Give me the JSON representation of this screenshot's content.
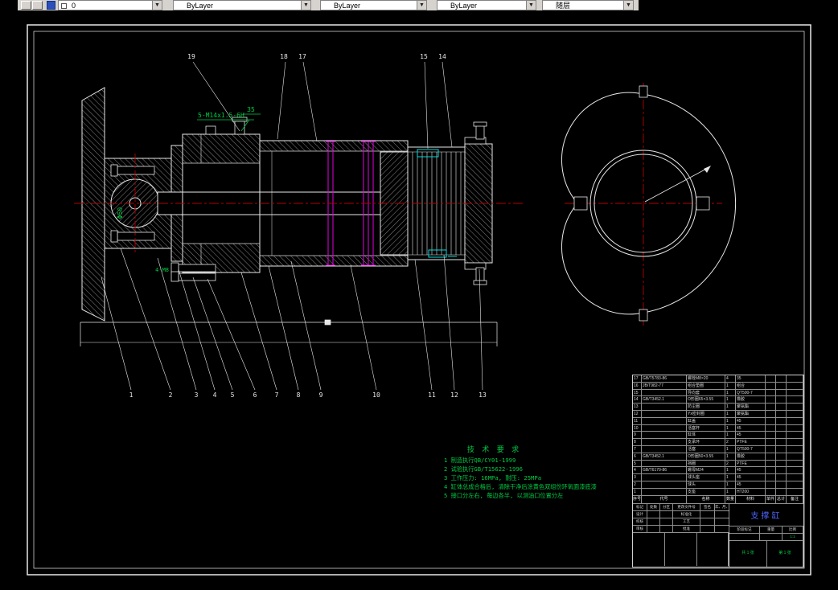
{
  "toolbar": {
    "layer_value": "0",
    "combo2_value": "ByLayer",
    "combo3_value": "ByLayer",
    "combo4_value": "ByLayer",
    "plot_style_value": "随层"
  },
  "drawing": {
    "thread_note": "5-M14x1.5-6H",
    "dim_35": "35",
    "dia_label": "Φ50",
    "bolt_note": "4-M8",
    "callouts_top": [
      "19",
      "18",
      "17",
      "15",
      "14"
    ],
    "callouts_bottom": [
      "1",
      "2",
      "3",
      "4",
      "5",
      "6",
      "7",
      "8",
      "9",
      "10",
      "11",
      "12",
      "13"
    ]
  },
  "tech_requirements": {
    "title": "技 术 要 求",
    "lines": [
      "1 制造执行QB/CY01-1999",
      "2 试验执行GB/T15622-1996",
      "3 工作压力: 16MPa, 耐压: 25MPa",
      "4 缸体总成合格后, 清除干净后涂黄色双组份环氧面漆底漆",
      "5 接口分左右, 每边各半, 以测油口位置分左"
    ]
  },
  "bom": {
    "headers": [
      "序号",
      "代号",
      "名称",
      "数量",
      "材料",
      "单件",
      "总计",
      "备注"
    ],
    "rows": [
      {
        "n": "17",
        "code": "GB/T5783-86",
        "name": "螺栓M8×20",
        "qty": "4",
        "mat": "35",
        "w1": "",
        "w2": "",
        "note": ""
      },
      {
        "n": "16",
        "code": "JB/T982-77",
        "name": "组合垫圈",
        "qty": "1",
        "mat": "组合",
        "w1": "",
        "w2": "",
        "note": ""
      },
      {
        "n": "15",
        "code": "",
        "name": "导向套",
        "qty": "1",
        "mat": "QT500-7",
        "w1": "",
        "w2": "",
        "note": ""
      },
      {
        "n": "14",
        "code": "GB/T3452.1",
        "name": "O形圈65×3.55",
        "qty": "1",
        "mat": "橡胶",
        "w1": "",
        "w2": "",
        "note": ""
      },
      {
        "n": "13",
        "code": "",
        "name": "防尘圈",
        "qty": "1",
        "mat": "聚氨酯",
        "w1": "",
        "w2": "",
        "note": ""
      },
      {
        "n": "12",
        "code": "",
        "name": "Yx密封圈",
        "qty": "1",
        "mat": "聚氨酯",
        "w1": "",
        "w2": "",
        "note": ""
      },
      {
        "n": "11",
        "code": "",
        "name": "缸盖",
        "qty": "1",
        "mat": "45",
        "w1": "",
        "w2": "",
        "note": ""
      },
      {
        "n": "10",
        "code": "",
        "name": "活塞杆",
        "qty": "1",
        "mat": "45",
        "w1": "",
        "w2": "",
        "note": ""
      },
      {
        "n": "9",
        "code": "",
        "name": "缸体",
        "qty": "1",
        "mat": "45",
        "w1": "",
        "w2": "",
        "note": ""
      },
      {
        "n": "8",
        "code": "",
        "name": "支承环",
        "qty": "2",
        "mat": "PTFE",
        "w1": "",
        "w2": "",
        "note": ""
      },
      {
        "n": "7",
        "code": "",
        "name": "活塞",
        "qty": "1",
        "mat": "QT500-7",
        "w1": "",
        "w2": "",
        "note": ""
      },
      {
        "n": "6",
        "code": "GB/T3452.1",
        "name": "O形圈50×3.55",
        "qty": "1",
        "mat": "橡胶",
        "w1": "",
        "w2": "",
        "note": ""
      },
      {
        "n": "5",
        "code": "",
        "name": "挡圈",
        "qty": "2",
        "mat": "PTFE",
        "w1": "",
        "w2": "",
        "note": ""
      },
      {
        "n": "4",
        "code": "GB/T6170-86",
        "name": "螺母M24",
        "qty": "1",
        "mat": "45",
        "w1": "",
        "w2": "",
        "note": ""
      },
      {
        "n": "3",
        "code": "",
        "name": "球头座",
        "qty": "1",
        "mat": "45",
        "w1": "",
        "w2": "",
        "note": ""
      },
      {
        "n": "2",
        "code": "",
        "name": "球头",
        "qty": "1",
        "mat": "45",
        "w1": "",
        "w2": "",
        "note": ""
      },
      {
        "n": "1",
        "code": "",
        "name": "支座",
        "qty": "1",
        "mat": "HT200",
        "w1": "",
        "w2": "",
        "note": ""
      }
    ]
  },
  "titleblock": {
    "title": "支撑缸",
    "r1": [
      "标记",
      "处数",
      "分区",
      "更改文件号",
      "签名",
      "年、月、日"
    ],
    "design": "设计",
    "std": "标准化",
    "check": "校核",
    "proc": "工艺",
    "audit": "审核",
    "approve": "批准",
    "stage": "阶段标记",
    "weight": "重量",
    "scale": "比例",
    "scale_value": "1:1",
    "sheets": "共 1 张",
    "sheet_no": "第 1 张"
  }
}
